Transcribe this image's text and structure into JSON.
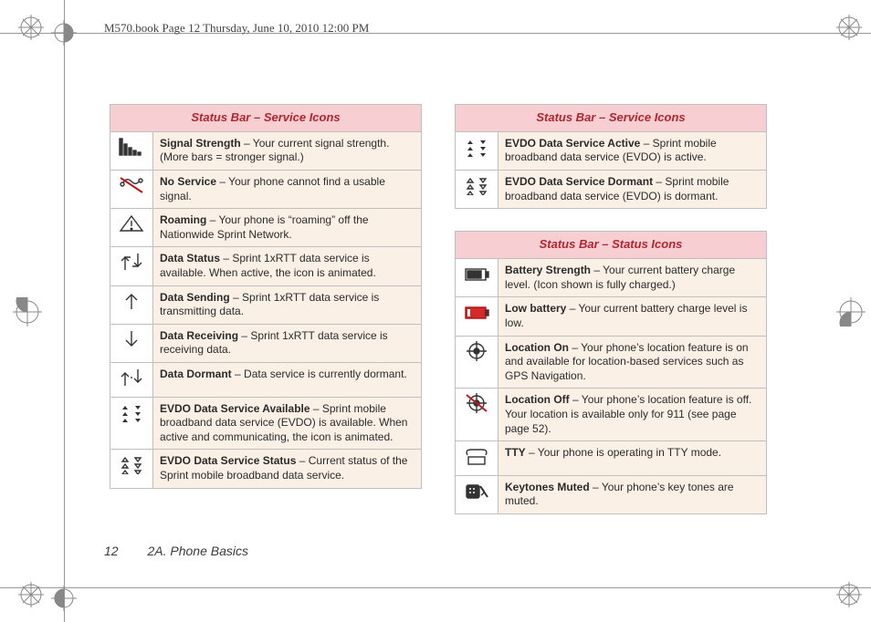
{
  "header": "M570.book  Page 12  Thursday, June 10, 2010  12:00 PM",
  "footer": {
    "page": "12",
    "section": "2A. Phone Basics"
  },
  "tables": {
    "service_left": {
      "title": "Status Bar – Service Icons",
      "rows": [
        {
          "icon": "signal-bars-icon",
          "term": "Signal Strength",
          "desc": " – Your current signal strength. (More bars = stronger signal.)"
        },
        {
          "icon": "no-service-icon",
          "term": "No Service",
          "desc": " – Your phone cannot find a usable signal."
        },
        {
          "icon": "roaming-icon",
          "term": "Roaming",
          "desc": " – Your phone is “roaming” off the Nationwide Sprint Network."
        },
        {
          "icon": "data-status-icon",
          "term": "Data Status",
          "desc": " – Sprint 1xRTT data service is available. When active, the icon is animated."
        },
        {
          "icon": "data-sending-icon",
          "term": "Data Sending",
          "desc": " – Sprint 1xRTT data service is transmitting data."
        },
        {
          "icon": "data-receiving-icon",
          "term": "Data Receiving",
          "desc": " – Sprint 1xRTT data service is receiving data."
        },
        {
          "icon": "data-dormant-icon",
          "term": "Data Dormant",
          "desc": " – Data service is currently dormant."
        },
        {
          "icon": "evdo-available-icon",
          "term": "EVDO Data Service Available",
          "desc": " – Sprint mobile broadband data service (EVDO) is available. When active and communicating, the icon is animated."
        },
        {
          "icon": "evdo-status-icon",
          "term": "EVDO Data Service Status",
          "desc": " – Current status of the Sprint mobile broadband data service."
        }
      ]
    },
    "service_right": {
      "title": "Status Bar – Service Icons",
      "rows": [
        {
          "icon": "evdo-active-icon",
          "term": "EVDO Data Service Active",
          "desc": " – Sprint mobile broadband data service (EVDO) is active."
        },
        {
          "icon": "evdo-dormant-icon",
          "term": "EVDO Data Service Dormant",
          "desc": " – Sprint mobile broadband data service (EVDO) is dormant."
        }
      ]
    },
    "status_right": {
      "title": "Status Bar – Status Icons",
      "rows": [
        {
          "icon": "battery-full-icon",
          "term": "Battery Strength",
          "desc": " – Your current battery charge level. (Icon shown is fully charged.)"
        },
        {
          "icon": "battery-low-icon",
          "term": "Low battery",
          "desc": " – Your current battery charge level is low.",
          "lowBattery": true
        },
        {
          "icon": "location-on-icon",
          "term": "Location On",
          "desc": " – Your phone’s location feature is on and available for location-based services such as GPS Navigation."
        },
        {
          "icon": "location-off-icon",
          "term": "Location Off",
          "desc": " – Your phone’s location feature is off. Your location is available only for 911 (see page page 52)."
        },
        {
          "icon": "tty-icon",
          "term": "TTY",
          "desc": " – Your phone is operating in TTY mode."
        },
        {
          "icon": "keytones-muted-icon",
          "term": "Keytones Muted",
          "desc": " – Your phone’s key tones are muted."
        }
      ]
    }
  }
}
